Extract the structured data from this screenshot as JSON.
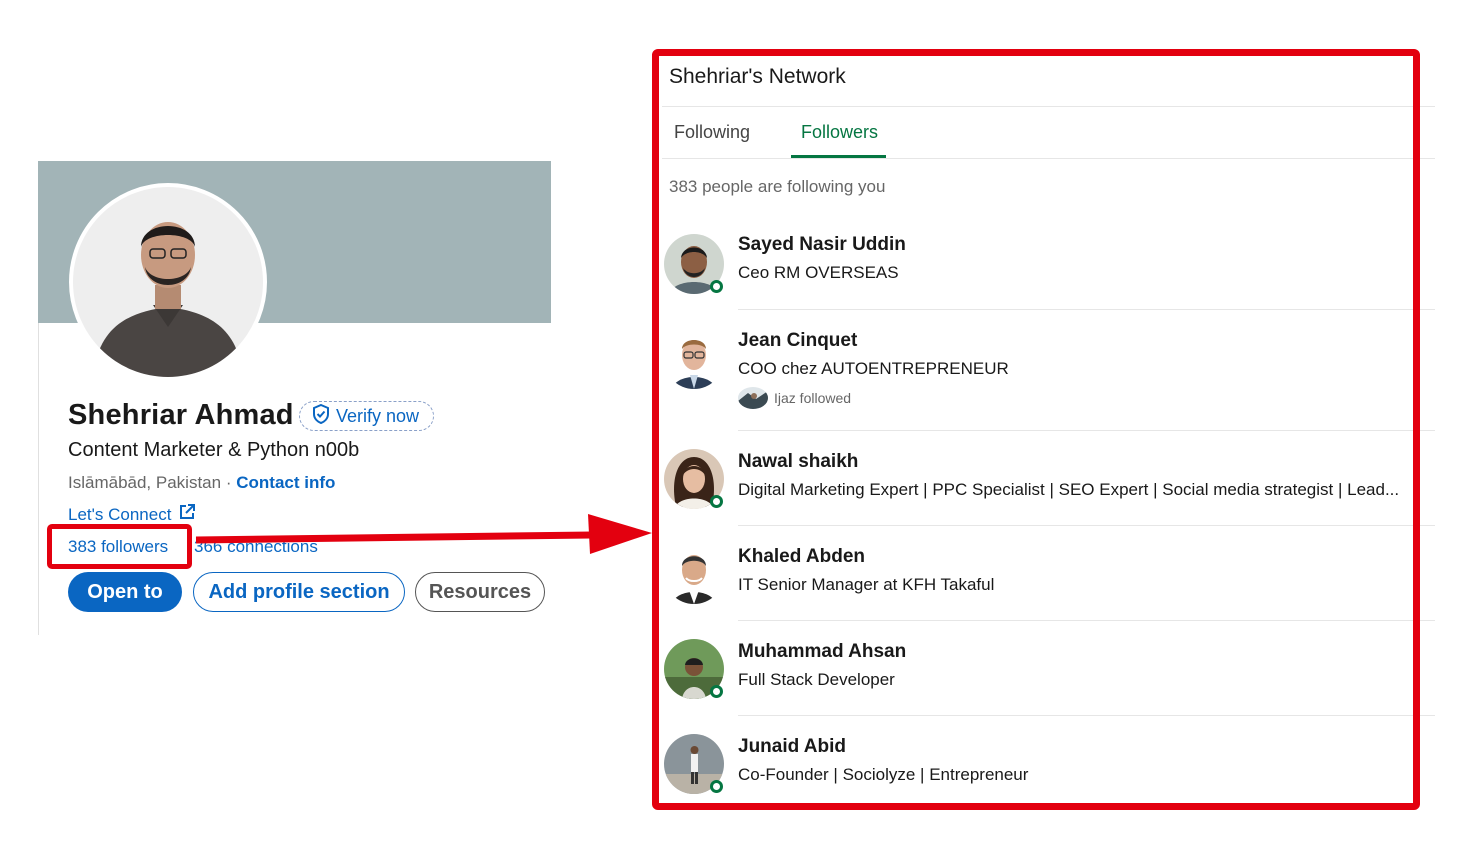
{
  "profile": {
    "name": "Shehriar Ahmad",
    "verify_label": "Verify now",
    "headline": "Content Marketer & Python n00b",
    "location": "Islāmābād, Pakistan",
    "separator": "·",
    "contact_info": "Contact info",
    "website_label": "Let's Connect",
    "followers": "383 followers",
    "connections": "366 connections",
    "buttons": {
      "open_to": "Open to",
      "add_section": "Add profile section",
      "resources": "Resources"
    },
    "banner_color": "#a2b4b7"
  },
  "network": {
    "title": "Shehriar's Network",
    "tabs": [
      {
        "label": "Following",
        "active": false
      },
      {
        "label": "Followers",
        "active": true
      }
    ],
    "count_text": "383 people are following you",
    "followers": [
      {
        "name": "Sayed Nasir Uddin",
        "headline": "Ceo RM OVERSEAS",
        "online": true
      },
      {
        "name": "Jean Cinquet",
        "headline": "COO chez AUTOENTREPRENEUR",
        "online": false,
        "insight": "Ijaz followed"
      },
      {
        "name": "Nawal shaikh",
        "headline": "Digital Marketing Expert | PPC Specialist | SEO Expert | Social media strategist | Lead...",
        "online": true
      },
      {
        "name": "Khaled Abden",
        "headline": "IT Senior Manager at KFH Takaful",
        "online": false
      },
      {
        "name": "Muhammad Ahsan",
        "headline": "Full Stack Developer",
        "online": true
      },
      {
        "name": "Junaid Abid",
        "headline": "Co-Founder | Sociolyze | Entrepreneur",
        "online": true
      }
    ]
  },
  "colors": {
    "linkedin_blue": "#0a66c2",
    "active_green": "#057642",
    "annotation_red": "#e3000f"
  },
  "icons": [
    "shield-check-icon",
    "external-link-icon",
    "online-status-icon"
  ]
}
